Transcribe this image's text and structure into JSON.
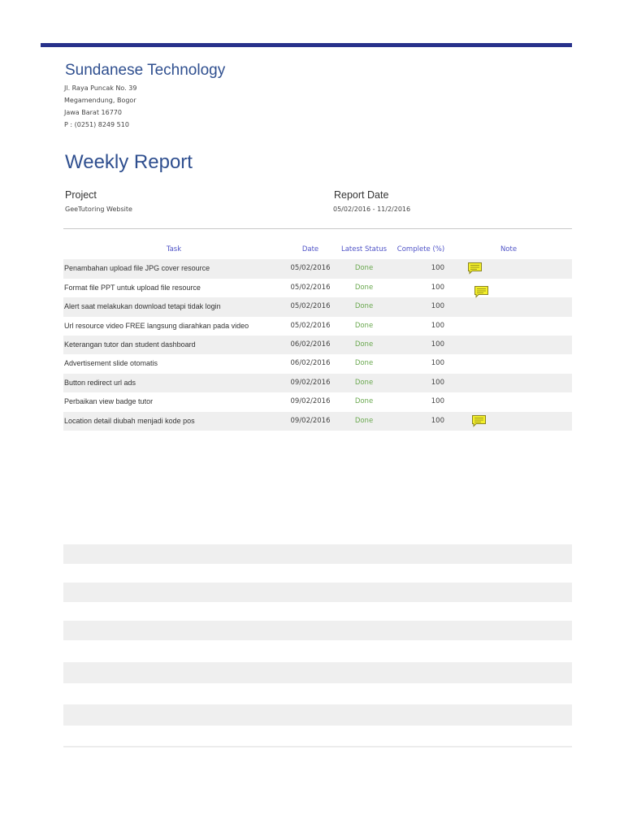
{
  "company": {
    "name": "Sundanese Technology",
    "address_lines": [
      "Jl. Raya Puncak No. 39",
      "Megamendung, Bogor",
      "Jawa Barat 16770",
      "P : (0251) 8249 510"
    ]
  },
  "report": {
    "title": "Weekly Report",
    "project_label": "Project",
    "project_value": "GeeTutoring Website",
    "date_label": "Report Date",
    "date_value": "05/02/2016 - 11/2/2016"
  },
  "table": {
    "headers": {
      "task": "Task",
      "date": "Date",
      "status": "Latest Status",
      "complete": "Complete (%)",
      "note": "Note"
    },
    "rows": [
      {
        "task": "Penambahan upload file JPG cover resource",
        "date": "05/02/2016",
        "status": "Done",
        "complete": "100",
        "note": "comment-icon"
      },
      {
        "task": "Format file PPT untuk upload file resource",
        "date": "05/02/2016",
        "status": "Done",
        "complete": "100",
        "note": "comment-icon"
      },
      {
        "task": "Alert saat melakukan download tetapi tidak login",
        "date": "05/02/2016",
        "status": "Done",
        "complete": "100",
        "note": ""
      },
      {
        "task": "Url resource video FREE langsung diarahkan pada video",
        "date": "05/02/2016",
        "status": "Done",
        "complete": "100",
        "note": ""
      },
      {
        "task": "Keterangan tutor dan student dashboard",
        "date": "06/02/2016",
        "status": "Done",
        "complete": "100",
        "note": ""
      },
      {
        "task": "Advertisement slide  otomatis",
        "date": "06/02/2016",
        "status": "Done",
        "complete": "100",
        "note": ""
      },
      {
        "task": "Button redirect url ads",
        "date": "09/02/2016",
        "status": "Done",
        "complete": "100",
        "note": ""
      },
      {
        "task": "Perbaikan view badge tutor",
        "date": "09/02/2016",
        "status": "Done",
        "complete": "100",
        "note": ""
      },
      {
        "task": "Location detail diubah menjadi kode pos",
        "date": "09/02/2016",
        "status": "Done",
        "complete": "100",
        "note": "comment-icon"
      }
    ]
  },
  "colors": {
    "accent_bar": "#27318b",
    "title_blue": "#2f4f8f",
    "header_blue": "#4f53c7",
    "done_green": "#6aa84f",
    "note_yellow": "#f3ef2a"
  }
}
